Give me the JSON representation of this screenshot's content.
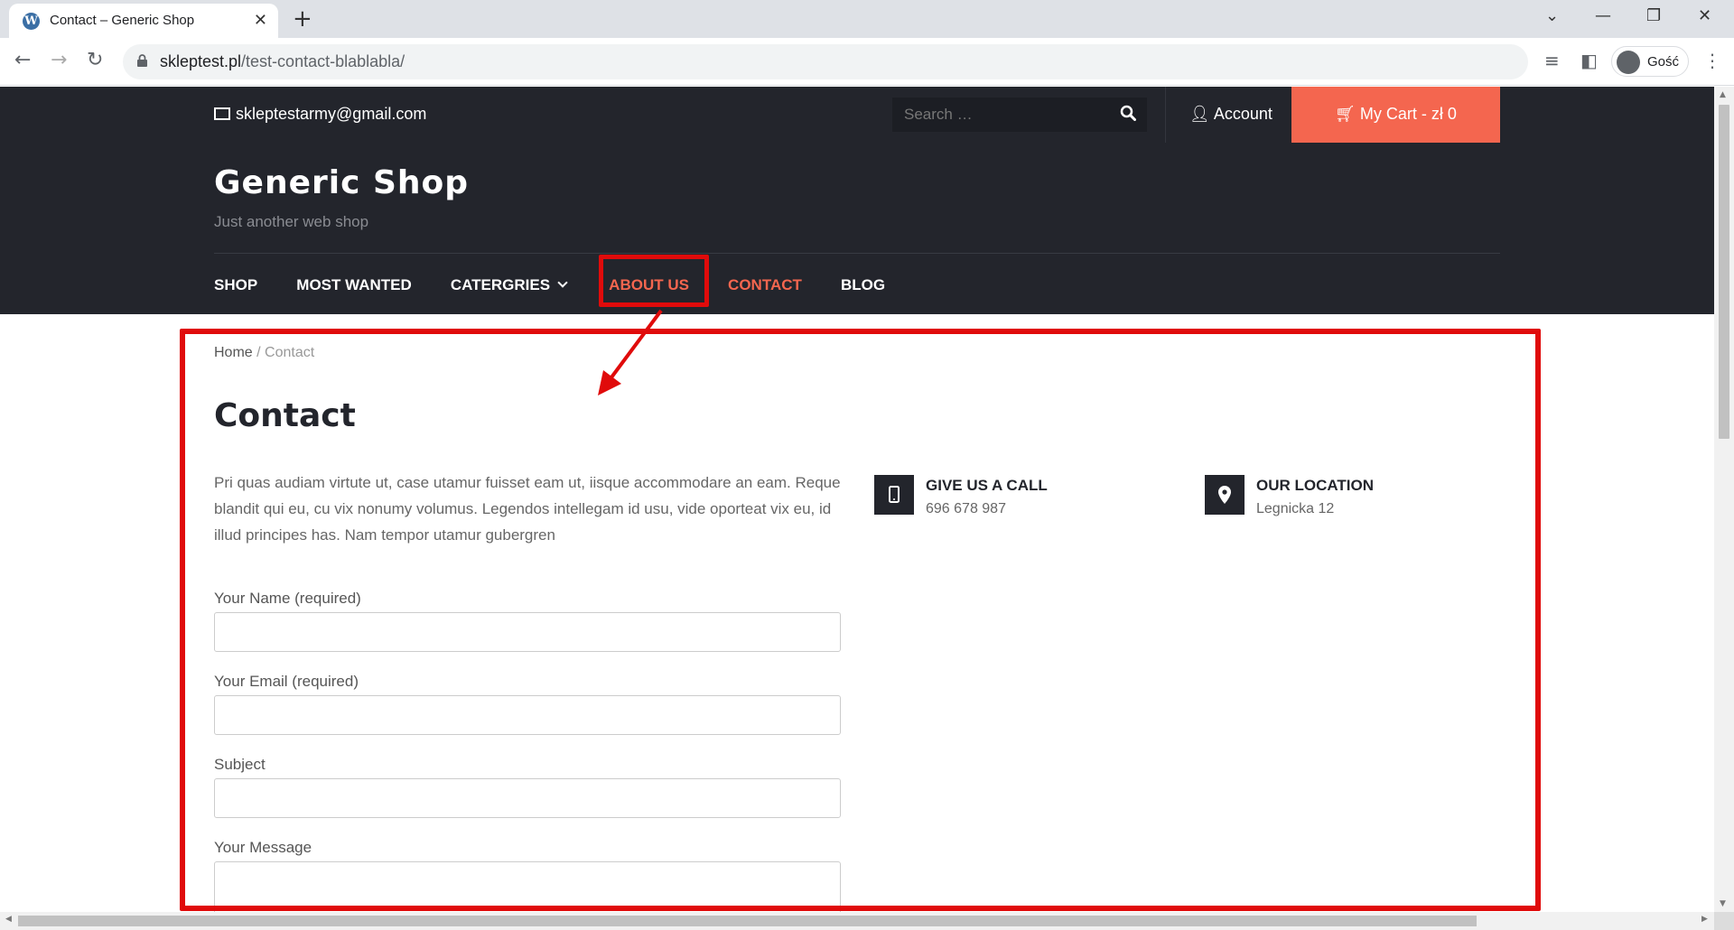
{
  "browser": {
    "tab_title": "Contact – Generic Shop",
    "favicon_letter": "W",
    "url_domain": "skleptest.pl",
    "url_path": "/test-contact-blablabla/",
    "profile_name": "Gość"
  },
  "topbar": {
    "email": "skleptestarmy@gmail.com",
    "search_placeholder": "Search …",
    "account_label": "Account",
    "cart_label": "My Cart - zł 0"
  },
  "header": {
    "site_title": "Generic Shop",
    "tagline": "Just another web shop",
    "menu": [
      {
        "label": "SHOP"
      },
      {
        "label": "MOST WANTED"
      },
      {
        "label": "CATERGRIES"
      },
      {
        "label": "ABOUT US"
      },
      {
        "label": "CONTACT"
      },
      {
        "label": "BLOG"
      }
    ]
  },
  "breadcrumb": {
    "home": "Home",
    "separator": "/",
    "current": "Contact"
  },
  "page": {
    "title": "Contact",
    "intro": "Pri quas audiam virtute ut, case utamur fuisset eam ut, iisque accommodare an eam. Reque blandit qui eu, cu vix nonumy volumus. Legendos intellegam id usu, vide oporteat vix eu, id illud principes has. Nam tempor utamur gubergren"
  },
  "form": {
    "name_label": "Your Name (required)",
    "email_label": "Your Email (required)",
    "subject_label": "Subject",
    "message_label": "Your Message",
    "name_value": "",
    "email_value": "",
    "subject_value": "",
    "message_value": ""
  },
  "contact_info": {
    "call_title": "GIVE US A CALL",
    "call_value": "696 678 987",
    "location_title": "OUR LOCATION",
    "location_value": "Legnicka 12"
  },
  "colors": {
    "header_bg": "#23252c",
    "accent": "#f4664f",
    "annotation": "#e00b0b"
  }
}
